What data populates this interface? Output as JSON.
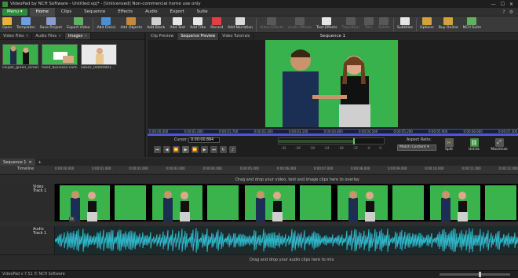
{
  "window": {
    "title": "VideoPad by NCH Software - Untitled.vpj* - [Unlicensed] Non-commercial home use only"
  },
  "menu": {
    "menu_button": "Menu ▾",
    "tabs": [
      "Home",
      "Clips",
      "Sequence",
      "Effects",
      "Audio",
      "Export",
      "Suite"
    ],
    "active_tab": "Home"
  },
  "toolbar": {
    "items": [
      {
        "label": "Open",
        "icon": "folder-icon",
        "color": "#e8b33a",
        "enabled": true
      },
      {
        "label": "Templates",
        "icon": "templates-icon",
        "color": "#6aa0e0",
        "enabled": true
      },
      {
        "label": "Save Project",
        "icon": "save-icon",
        "color": "#8a9bd0",
        "enabled": true
      },
      {
        "label": "Export Video",
        "icon": "export-icon",
        "color": "#5fb35f",
        "enabled": true
      },
      {
        "label": "Add File(s)",
        "icon": "add-file-icon",
        "color": "#4a8fd6",
        "enabled": true
      },
      {
        "label": "Add Objects",
        "icon": "add-objects-icon",
        "color": "#c48a3a",
        "enabled": true
      },
      {
        "label": "Add Blank",
        "icon": "add-blank-icon",
        "color": "#cfcfcf",
        "enabled": true
      },
      {
        "label": "Add Text",
        "icon": "add-text-icon",
        "color": "#e6e6e6",
        "enabled": true
      },
      {
        "label": "Add Title",
        "icon": "add-title-icon",
        "color": "#e6e6e6",
        "enabled": true
      },
      {
        "label": "Record",
        "icon": "record-icon",
        "color": "#e04040",
        "enabled": true
      },
      {
        "label": "Add Narration",
        "icon": "microphone-icon",
        "color": "#d9d9d9",
        "enabled": true
      },
      {
        "label": "Video Effects",
        "icon": "video-effects-icon",
        "color": "#888888",
        "enabled": false
      },
      {
        "label": "Audio Effects",
        "icon": "audio-effects-icon",
        "color": "#888888",
        "enabled": false
      },
      {
        "label": "Text Effects",
        "icon": "text-effects-icon",
        "color": "#e6e6e6",
        "enabled": true
      },
      {
        "label": "Transition",
        "icon": "transition-icon",
        "color": "#888888",
        "enabled": false
      },
      {
        "label": "Trim",
        "icon": "trim-icon",
        "color": "#888888",
        "enabled": false
      },
      {
        "label": "Delete",
        "icon": "delete-icon",
        "color": "#888888",
        "enabled": false
      },
      {
        "label": "Subtitles",
        "icon": "subtitles-icon",
        "color": "#e6e6e6",
        "enabled": true
      },
      {
        "label": "Options",
        "icon": "options-icon",
        "color": "#d4a23a",
        "enabled": true
      },
      {
        "label": "Buy Online",
        "icon": "cart-icon",
        "color": "#d4a23a",
        "enabled": true
      },
      {
        "label": "NCH Suite",
        "icon": "suite-icon",
        "color": "#5fb35f",
        "enabled": true
      }
    ]
  },
  "media_bin": {
    "tabs": [
      {
        "label": "Video Files"
      },
      {
        "label": "Audio Files"
      },
      {
        "label": "Images"
      }
    ],
    "active_tab": "Images",
    "items": [
      {
        "name": "couple_green_screen..."
      },
      {
        "name": "hand_business-card.jpg"
      },
      {
        "name": "iStock_00000891..."
      }
    ]
  },
  "preview": {
    "tabs": [
      "Clip Preview",
      "Sequence Preview",
      "Video Tutorials"
    ],
    "active_tab": "Sequence Preview",
    "title": "Sequence 1",
    "ruler_ticks": [
      "0:00:00.000",
      "0:00:01.000",
      "0:00:01.700",
      "0:00:02.400",
      "0:00:03.100",
      "0:00:03.800",
      "0:00:04.500",
      "0:00:05.200",
      "0:00:05.900",
      "0:00:06.600",
      "0:00:07.300"
    ],
    "cursor_label": "Cursor:",
    "cursor_value": "0:00:00.884",
    "meter_scale": [
      "-42",
      "-36",
      "-30",
      "-24",
      "-18",
      "-12",
      "-6",
      "0"
    ],
    "aspect_label": "Aspect Ratio:",
    "aspect_value": "Match Content",
    "split_label": "Split",
    "unlink_label": "Unlink",
    "maximize_label": "Maximize"
  },
  "sequence": {
    "tab_label": "Sequence 1",
    "timeline_label": "Timeline",
    "timeline_ticks": [
      "0:00:00.000",
      "0:00:01.000",
      "0:00:02.000",
      "0:00:03.000",
      "0:00:04.000",
      "0:00:05.000",
      "0:00:06.000",
      "0:00:07.000",
      "0:00:08.000",
      "0:00:09.000",
      "0:00:10.000",
      "0:00:11.000",
      "0:00:12.000"
    ],
    "video_hint": "Drag and drop your video, text and image clips here to overlay",
    "video_track": "Video Track 1",
    "audio_track": "Audio Track 1",
    "audio_hint": "Drag and drop your audio clips here to mix",
    "fx_label": "fx"
  },
  "status": {
    "text": "VideoPad v 7.51 © NCH Software"
  }
}
